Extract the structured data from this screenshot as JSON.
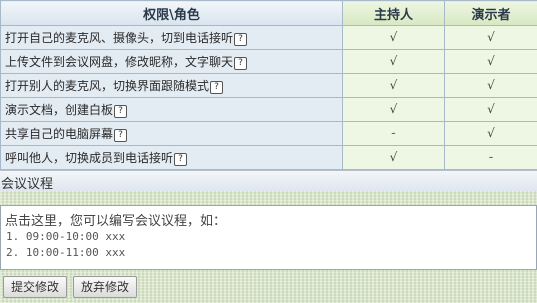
{
  "table": {
    "headers": {
      "permission_role": "权限\\角色",
      "host": "主持人",
      "presenter": "演示者"
    },
    "help_glyph": "?",
    "rows": [
      {
        "label": "打开自己的麦克风、摄像头，切到电话接听",
        "host": "√",
        "presenter": "√"
      },
      {
        "label": "上传文件到会议网盘，修改昵称，文字聊天",
        "host": "√",
        "presenter": "√"
      },
      {
        "label": "打开别人的麦克风，切换界面跟随模式",
        "host": "√",
        "presenter": "√"
      },
      {
        "label": "演示文档，创建白板",
        "host": "√",
        "presenter": "√"
      },
      {
        "label": "共享自己的电脑屏幕",
        "host": "-",
        "presenter": "√"
      },
      {
        "label": "呼叫他人，切换成员到电话接听",
        "host": "√",
        "presenter": "-"
      }
    ]
  },
  "agenda": {
    "title": "会议议程",
    "placeholder": "点击这里，您可以编写会议议程，如：",
    "example_line_1": "1. 09:00-10:00 xxx",
    "example_line_2": "2. 10:00-11:00 xxx",
    "submit_label": "提交修改",
    "discard_label": "放弃修改"
  },
  "colors": {
    "header_bg": "#dbe6ef",
    "name_cell_bg": "#e3ebf3",
    "mark_cell_bg": "#eef7e3",
    "pattern_bg": "#d9e7c8"
  }
}
